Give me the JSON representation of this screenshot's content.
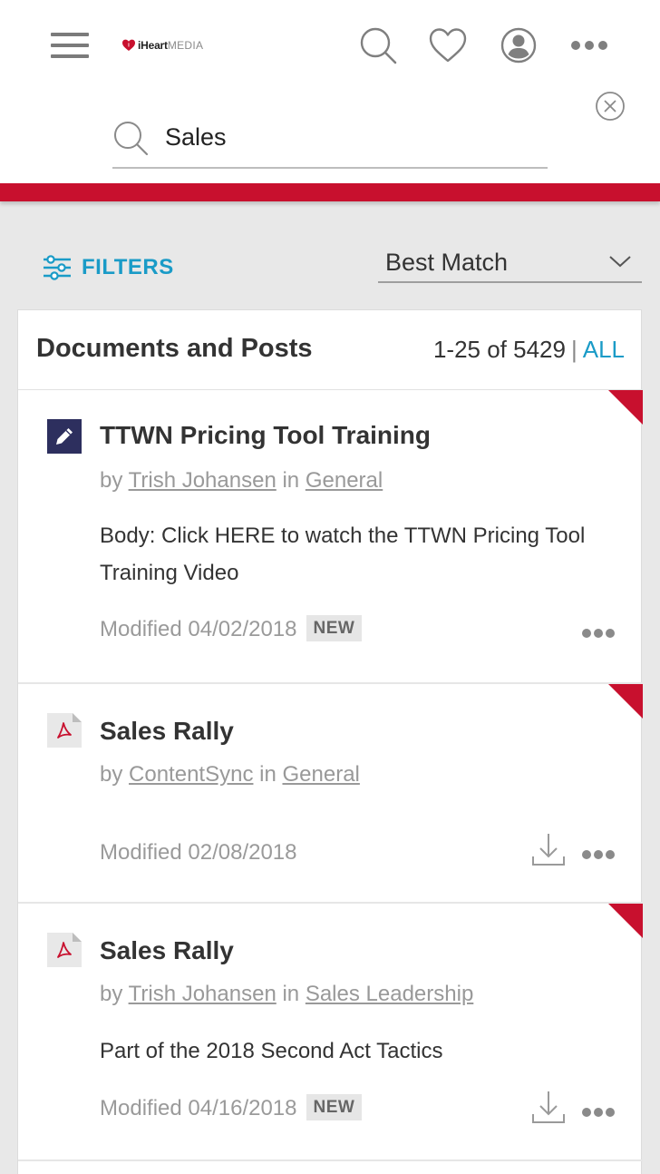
{
  "header": {
    "brand_primary": "iHeart",
    "brand_secondary": "MEDIA",
    "search_value": "Sales",
    "search_placeholder": "Search"
  },
  "colors": {
    "accent_red": "#c8102e",
    "link_blue": "#1a9bc7"
  },
  "icons": {
    "menu": "hamburger-icon",
    "search": "search-icon",
    "favorites": "heart-icon",
    "account": "user-icon",
    "more": "more-icon",
    "clear": "close-circle-icon",
    "filters": "sliders-icon",
    "sort": "chevron-down-icon",
    "post": "pencil-icon",
    "pdf": "pdf-icon",
    "download": "download-icon"
  },
  "toolbar": {
    "filters_label": "FILTERS",
    "sort_label": "Best Match"
  },
  "results": {
    "title": "Documents and Posts",
    "range": "1-25 of 5429",
    "all_label": "ALL",
    "items": [
      {
        "title": "TTWN Pricing Tool Training",
        "by_prefix": "by",
        "author": "Trish Johansen",
        "in_prefix": "in",
        "place": "General",
        "body": "Body: Click HERE to watch the TTWN Pricing Tool Training Video",
        "modified": "Modified 04/02/2018",
        "badge": "NEW",
        "type": "post"
      },
      {
        "title": "Sales Rally",
        "by_prefix": "by",
        "author": "ContentSync",
        "in_prefix": "in",
        "place": "General",
        "body": "",
        "modified": "Modified 02/08/2018",
        "badge": "",
        "type": "pdf"
      },
      {
        "title": "Sales Rally",
        "by_prefix": "by",
        "author": "Trish Johansen",
        "in_prefix": "in",
        "place": "Sales Leadership",
        "body": "Part of the 2018 Second Act Tactics",
        "modified": "Modified 04/16/2018",
        "badge": "NEW",
        "type": "pdf"
      }
    ]
  }
}
